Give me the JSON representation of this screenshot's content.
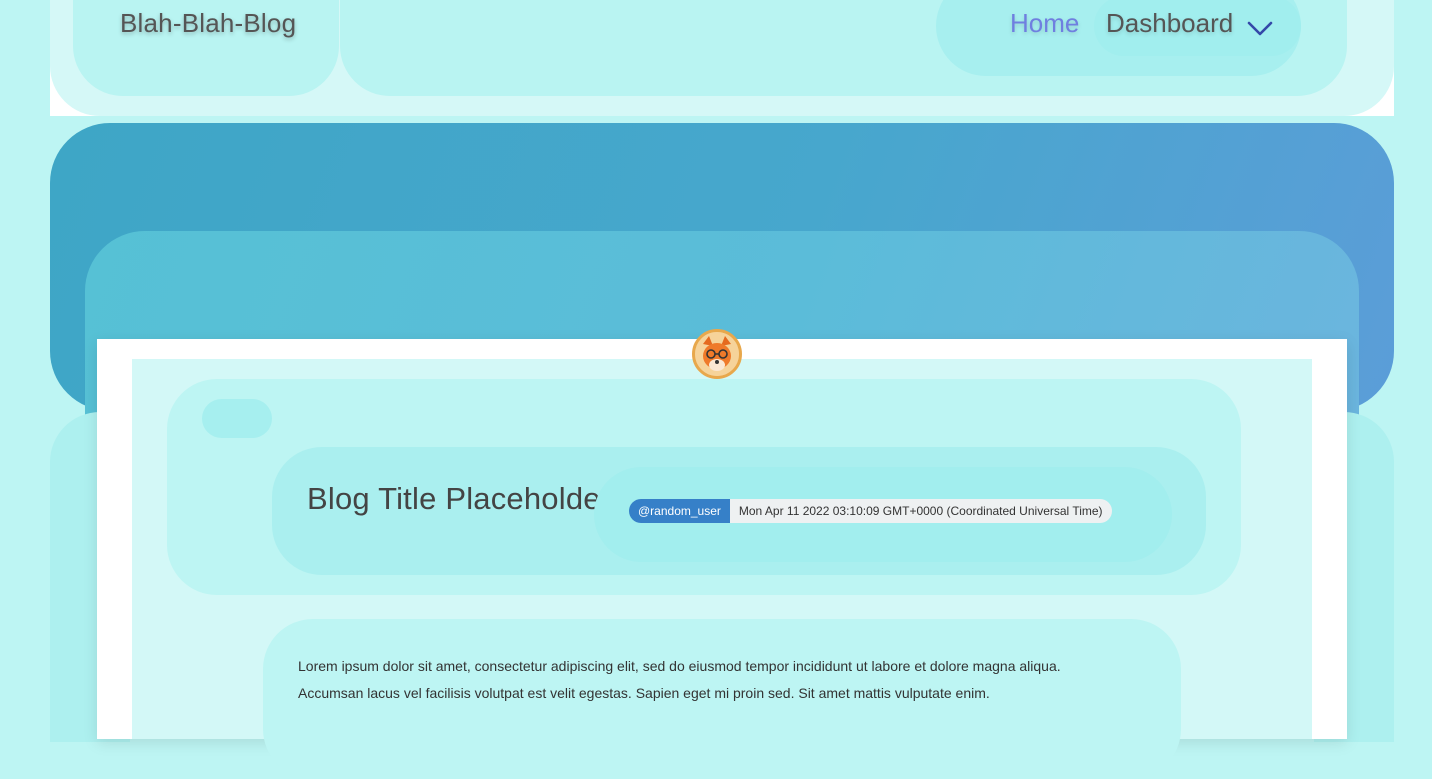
{
  "nav": {
    "brand": "Blah-Blah-Blog",
    "home_label": "Home",
    "dashboard_label": "Dashboard"
  },
  "post": {
    "title": "Blog Title Placeholder..",
    "author": "@random_user",
    "date": "Mon Apr 11 2022 03:10:09 GMT+0000 (Coordinated Universal Time)",
    "body": [
      "Lorem ipsum dolor sit amet, consectetur adipiscing elit, sed do eiusmod tempor incididunt ut labore et dolore magna aliqua.",
      "Accumsan lacus vel facilisis volutpat est velit egestas. Sapien eget mi proin sed. Sit amet mattis vulputate enim."
    ]
  },
  "icons": {
    "dashboard_toggle": "chevron-down-icon",
    "avatar": "fox-avatar"
  },
  "colors": {
    "background": "#bdf5f3",
    "hero": "#47a7cd",
    "user_badge": "#3680c8",
    "home_link": "#6f7fe0"
  }
}
